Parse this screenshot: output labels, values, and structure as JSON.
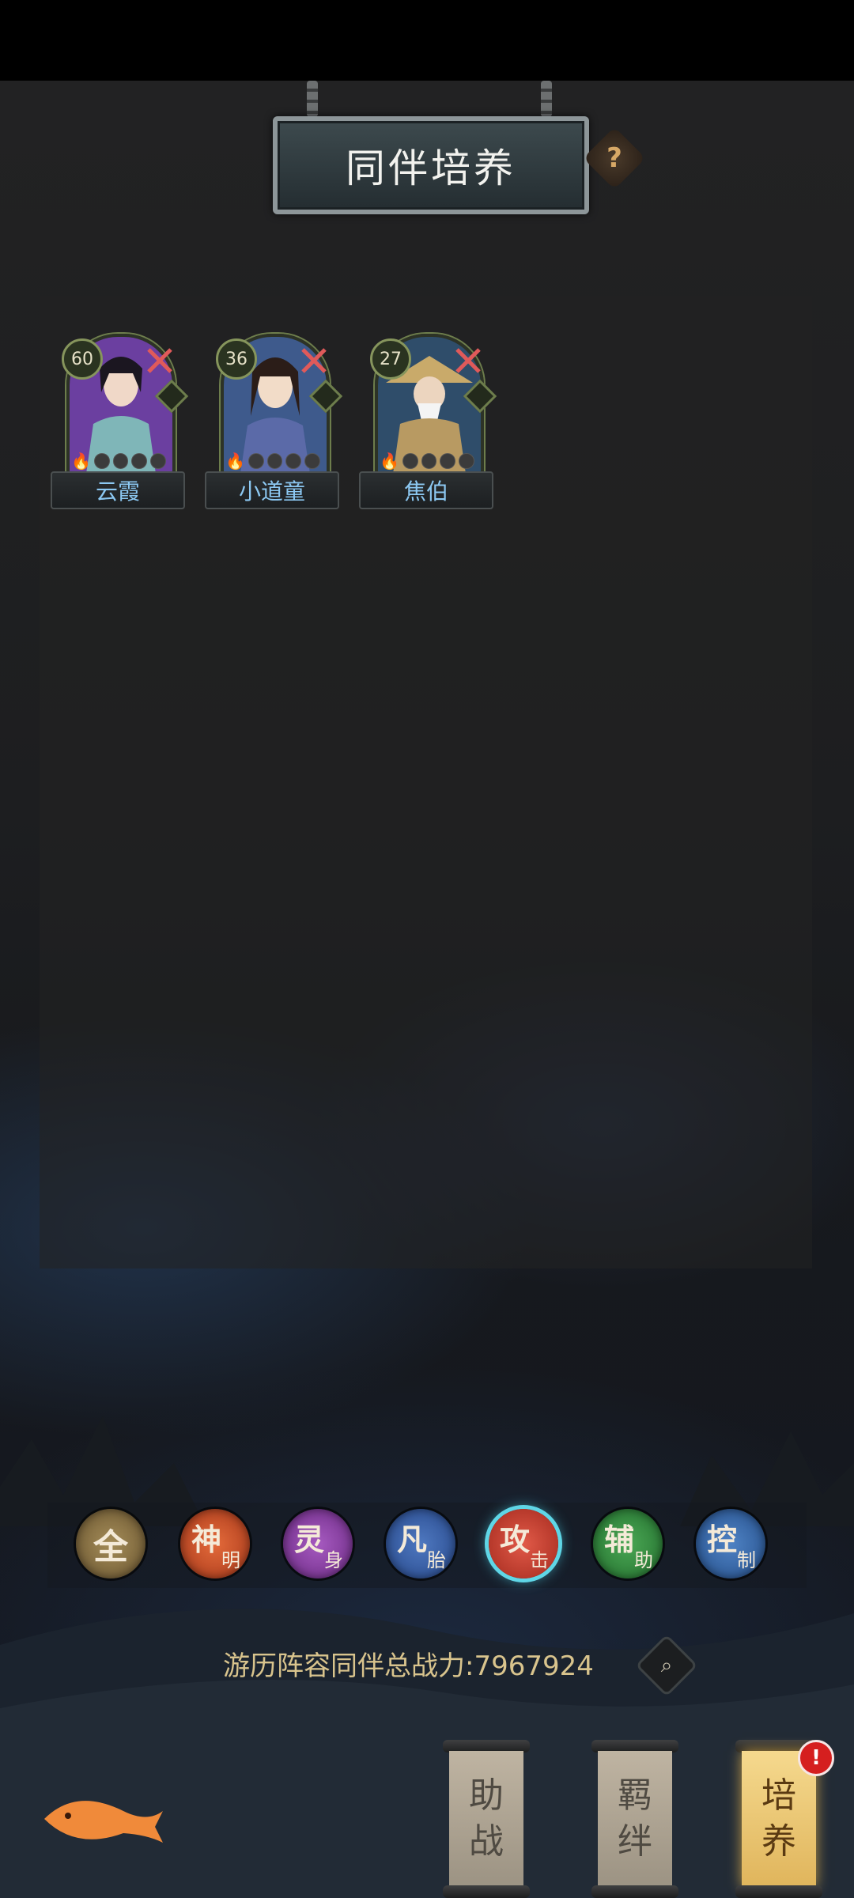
{
  "header": {
    "title": "同伴培养",
    "help_icon": "question-mark-icon"
  },
  "companions": [
    {
      "level": "60",
      "name": "云霞",
      "theme": "#6b3fa0"
    },
    {
      "level": "36",
      "name": "小道童",
      "theme": "#3e5a8c"
    },
    {
      "level": "27",
      "name": "焦伯",
      "theme": "#2f4d6a"
    }
  ],
  "filters": [
    {
      "big": "全",
      "small": "",
      "color": "#8a7448",
      "active": false
    },
    {
      "big": "神",
      "small": "明",
      "color": "#c8481c",
      "active": false
    },
    {
      "big": "灵",
      "small": "身",
      "color": "#8b3aa0",
      "active": false
    },
    {
      "big": "凡",
      "small": "胎",
      "color": "#34579c",
      "active": false
    },
    {
      "big": "攻",
      "small": "击",
      "color": "#c23a2e",
      "active": true
    },
    {
      "big": "辅",
      "small": "助",
      "color": "#2f8a3a",
      "active": false
    },
    {
      "big": "控",
      "small": "制",
      "color": "#2f5f9c",
      "active": false
    }
  ],
  "power": {
    "label": "游历阵容同伴总战力:7967924"
  },
  "tabs": [
    {
      "line1": "助",
      "line2": "战",
      "active": false
    },
    {
      "line1": "羁",
      "line2": "绊",
      "active": false
    },
    {
      "line1": "培",
      "line2": "养",
      "active": true
    }
  ],
  "alert": {
    "text": "!"
  }
}
